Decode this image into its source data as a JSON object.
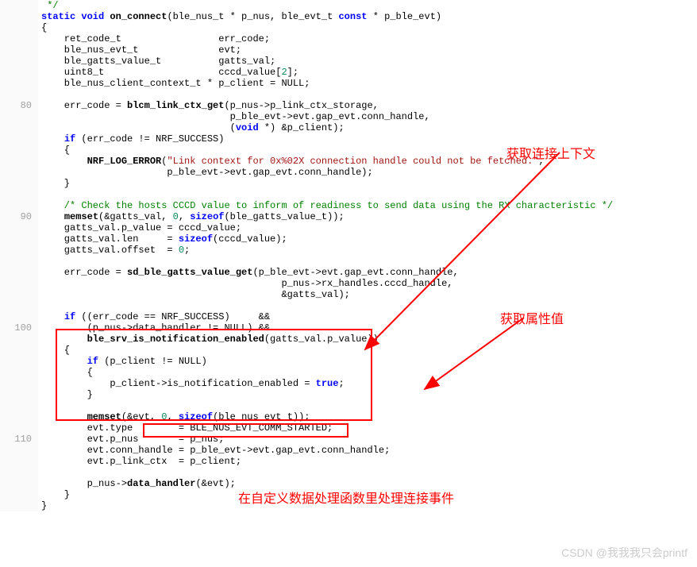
{
  "gutter": {
    "l80": "80",
    "l90": "90",
    "l100": "100",
    "l110": "110"
  },
  "code": {
    "l1": " */",
    "l2a": "static void",
    "l2b": " on_connect",
    "l2c": "(ble_nus_t * p_nus, ble_evt_t ",
    "l2d": "const",
    "l2e": " * p_ble_evt)",
    "l3": "{",
    "l4": "    ret_code_t                 err_code;",
    "l5": "    ble_nus_evt_t              evt;",
    "l6": "    ble_gatts_value_t          gatts_val;",
    "l7a": "    uint8_t                    cccd_value[",
    "l7b": "2",
    "l7c": "];",
    "l8": "    ble_nus_client_context_t * p_client = NULL;",
    "l9": "",
    "l10a": "    err_code = ",
    "l10b": "blcm_link_ctx_get",
    "l10c": "(p_nus->p_link_ctx_storage,",
    "l11": "                                 p_ble_evt->evt.gap_evt.conn_handle,",
    "l12a": "                                 (",
    "l12b": "void",
    "l12c": " *) &p_client);",
    "l13a": "    ",
    "l13b": "if",
    "l13c": " (err_code != NRF_SUCCESS)",
    "l14": "    {",
    "l15a": "        ",
    "l15b": "NRF_LOG_ERROR",
    "l15c": "(",
    "l15d": "\"Link context for 0x%02X connection handle could not be fetched.\"",
    "l15e": ",",
    "l16": "                      p_ble_evt->evt.gap_evt.conn_handle);",
    "l17": "    }",
    "l18": "",
    "l19": "    /* Check the hosts CCCD value to inform of readiness to send data using the RX characteristic */",
    "l20a": "    ",
    "l20b": "memset",
    "l20c": "(&gatts_val, ",
    "l20d": "0",
    "l20e": ", ",
    "l20f": "sizeof",
    "l20g": "(ble_gatts_value_t));",
    "l21": "    gatts_val.p_value = cccd_value;",
    "l22a": "    gatts_val.len     = ",
    "l22b": "sizeof",
    "l22c": "(cccd_value);",
    "l23a": "    gatts_val.offset  = ",
    "l23b": "0",
    "l23c": ";",
    "l24": "",
    "l25a": "    err_code = ",
    "l25b": "sd_ble_gatts_value_get",
    "l25c": "(p_ble_evt->evt.gap_evt.conn_handle,",
    "l26": "                                          p_nus->rx_handles.cccd_handle,",
    "l27": "                                          &gatts_val);",
    "l28": "",
    "l29a": "    ",
    "l29b": "if",
    "l29c": " ((err_code == NRF_SUCCESS)     &&",
    "l30": "        (p_nus->data_handler != NULL) &&",
    "l31a": "        ",
    "l31b": "ble_srv_is_notification_enabled",
    "l31c": "(gatts_val.p_value))",
    "l32": "    {",
    "l33a": "        ",
    "l33b": "if",
    "l33c": " (p_client != NULL)",
    "l34": "        {",
    "l35a": "            p_client->is_notification_enabled = ",
    "l35b": "true",
    "l35c": ";",
    "l36": "        }",
    "l37": "",
    "l38a": "        ",
    "l38b": "memset",
    "l38c": "(&evt, ",
    "l38d": "0",
    "l38e": ", ",
    "l38f": "sizeof",
    "l38g": "(ble_nus_evt_t));",
    "l39": "        evt.type        = BLE_NUS_EVT_COMM_STARTED;",
    "l40": "        evt.p_nus       = p_nus;",
    "l41": "        evt.conn_handle = p_ble_evt->evt.gap_evt.conn_handle;",
    "l42": "        evt.p_link_ctx  = p_client;",
    "l43": "",
    "l44a": "        p_nus->",
    "l44b": "data_handler",
    "l44c": "(&evt);",
    "l45": "    }",
    "l46": "}"
  },
  "annotations": {
    "a1": "获取连接上下文",
    "a2": "获取属性值",
    "a3": "在自定义数据处理函数里处理连接事件"
  },
  "watermark": "CSDN @我我我只会printf"
}
